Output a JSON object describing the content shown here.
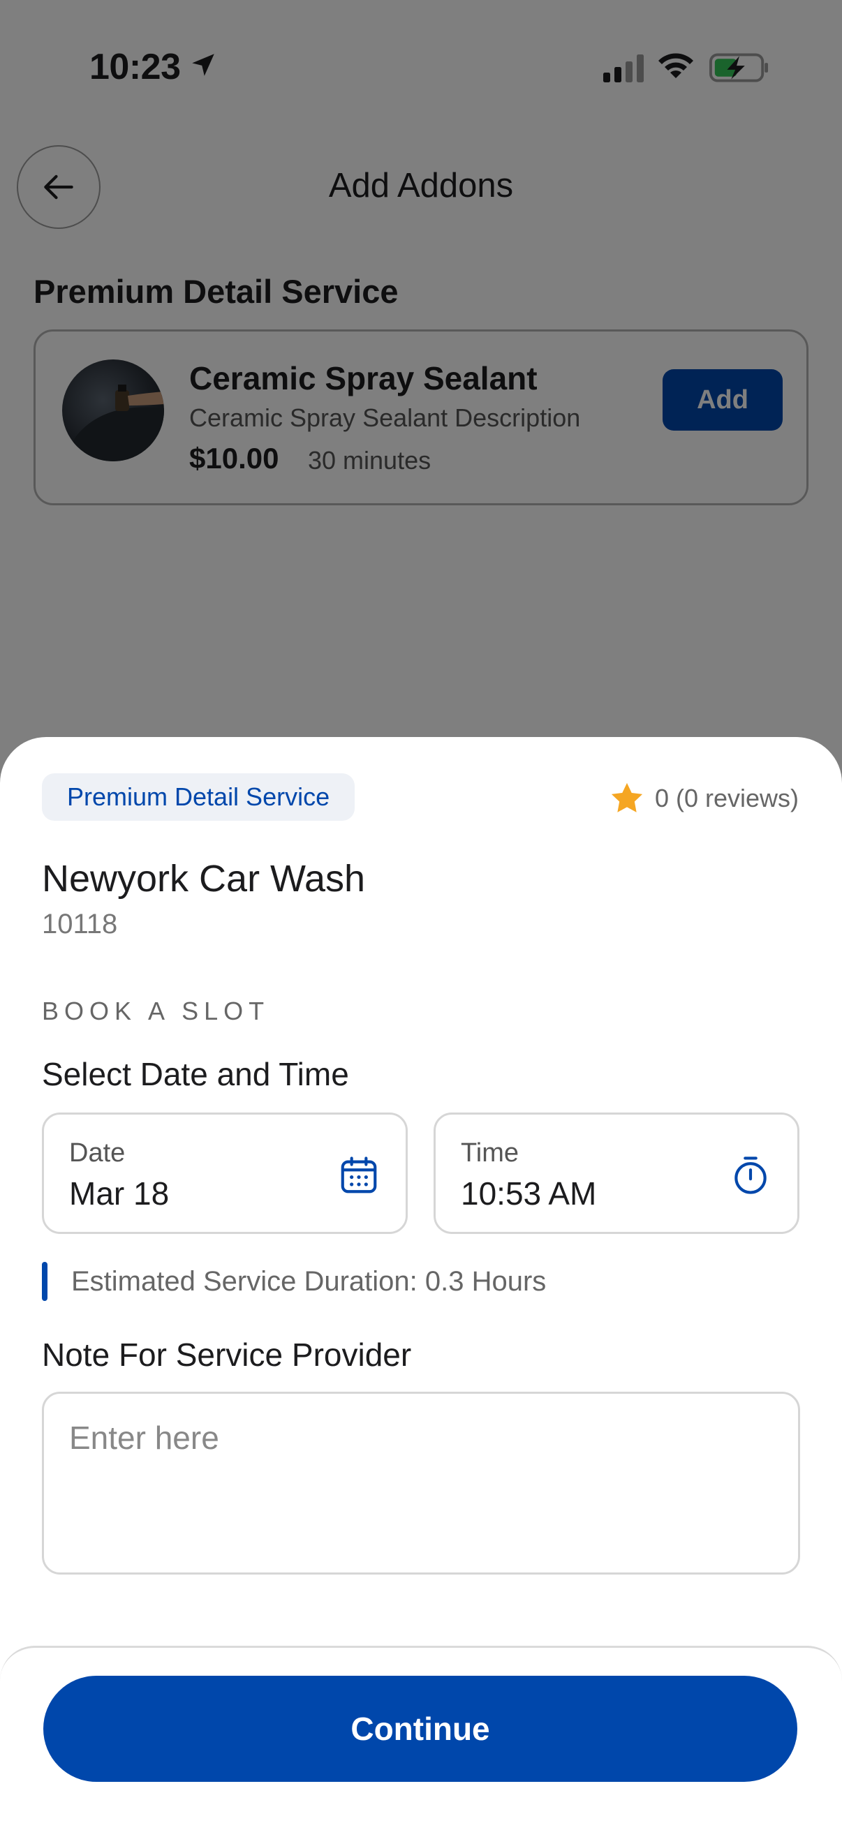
{
  "status_bar": {
    "time": "10:23"
  },
  "header": {
    "title": "Add Addons"
  },
  "background": {
    "section_title": "Premium Detail Service",
    "addon": {
      "name": "Ceramic Spray Sealant",
      "description": "Ceramic Spray Sealant Description",
      "price": "$10.00",
      "duration": "30 minutes",
      "add_label": "Add"
    }
  },
  "sheet": {
    "service_tag": "Premium Detail Service",
    "rating_text": "0 (0 reviews)",
    "business_name": "Newyork Car Wash",
    "zip": "10118",
    "book_label": "BOOK A SLOT",
    "select_label": "Select Date and Time",
    "date": {
      "label": "Date",
      "value": "Mar 18"
    },
    "time": {
      "label": "Time",
      "value": "10:53 AM"
    },
    "duration_text": "Estimated Service Duration: 0.3 Hours",
    "note_label": "Note For Service Provider",
    "note_placeholder": "Enter here",
    "continue_label": "Continue"
  },
  "colors": {
    "accent": "#0047ab",
    "star": "#f5a623",
    "tag_bg": "#eef1f6"
  }
}
